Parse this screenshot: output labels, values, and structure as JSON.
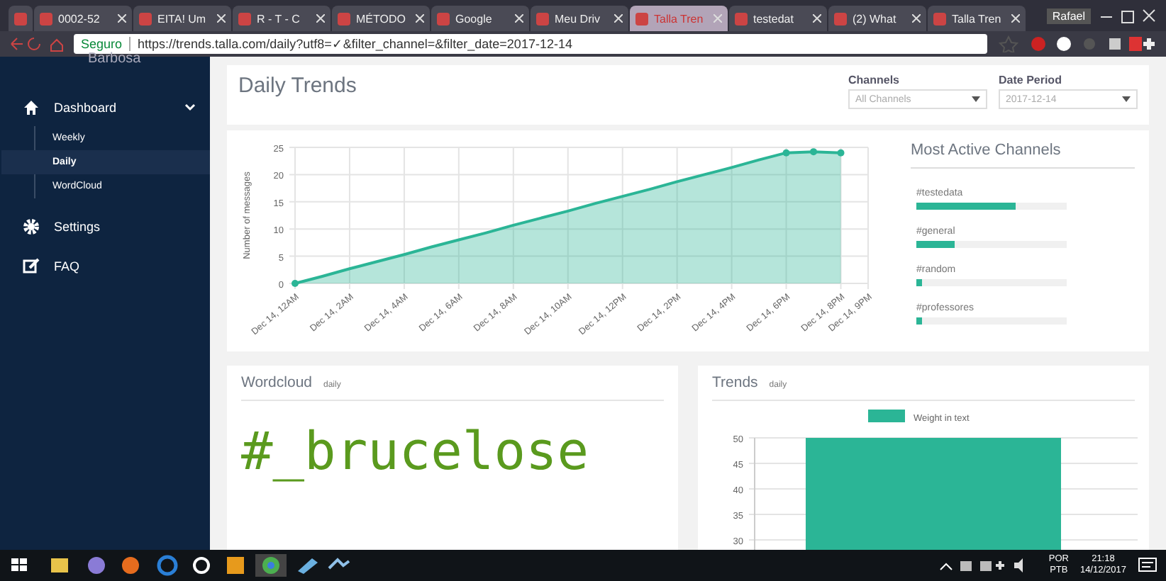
{
  "browser": {
    "tabs": [
      {
        "selected": false
      },
      {
        "title": "0002-52",
        "selected": false
      },
      {
        "title": "EITA! Um",
        "selected": false
      },
      {
        "title": "R - T - C",
        "selected": false
      },
      {
        "title": "MÉTODO",
        "selected": false
      },
      {
        "title": "Google",
        "selected": false
      },
      {
        "title": "Meu Driv",
        "selected": false
      },
      {
        "title": "Talla Tren",
        "selected": true
      },
      {
        "title": "testedat",
        "selected": false
      },
      {
        "title": "(2) What",
        "selected": false
      },
      {
        "title": "Talla Tren",
        "selected": false
      }
    ],
    "user": "Rafael",
    "secure_label": "Seguro",
    "url": "https://trends.talla.com/daily?utf8=✓&filter_channel=&filter_date=2017-12-14"
  },
  "sidebar": {
    "user_name": "Barbosa",
    "items": [
      {
        "label": "Dashboard",
        "expanded": true,
        "children": [
          {
            "label": "Weekly",
            "selected": false
          },
          {
            "label": "Daily",
            "selected": true
          },
          {
            "label": "WordCloud",
            "selected": false
          }
        ]
      },
      {
        "label": "Settings"
      },
      {
        "label": "FAQ"
      }
    ]
  },
  "header": {
    "title": "Daily Trends",
    "filters": [
      {
        "label": "Channels",
        "value": "All Channels"
      },
      {
        "label": "Date Period",
        "value": "2017-12-14"
      }
    ]
  },
  "trend_chart": {
    "chart_data": {
      "type": "area",
      "ylabel": "Number of messages",
      "grid": true,
      "ylim": [
        0,
        25
      ],
      "yticks": [
        0,
        5,
        10,
        15,
        20,
        25
      ],
      "categories": [
        "Dec 14, 12AM",
        null,
        "Dec 14, 2AM",
        null,
        "Dec 14, 4AM",
        null,
        "Dec 14, 6AM",
        null,
        "Dec 14, 8AM",
        null,
        "Dec 14, 10AM",
        null,
        "Dec 14, 12PM",
        null,
        "Dec 14, 2PM",
        null,
        "Dec 14, 4PM",
        null,
        "Dec 14, 6PM",
        null,
        "Dec 14, 8PM",
        "Dec 14, 9PM"
      ],
      "series": [
        {
          "color": "#2bb596",
          "values": [
            0,
            1.3,
            2.7,
            4,
            5.3,
            6.7,
            8,
            9.3,
            10.7,
            12,
            13.3,
            14.7,
            16,
            17.3,
            18.7,
            20,
            21.3,
            22.7,
            24,
            24.2,
            24,
            null
          ]
        }
      ]
    }
  },
  "active_channels": {
    "title": "Most Active Channels",
    "channels": [
      {
        "name": "#testedata",
        "level": 0.66
      },
      {
        "name": "#general",
        "level": 0.25
      },
      {
        "name": "#random",
        "level": 0.04
      },
      {
        "name": "#professores",
        "level": 0.04
      }
    ]
  },
  "wordcloud": {
    "title": "Wordcloud",
    "period": "daily",
    "words": [
      "#_brucelose"
    ]
  },
  "trends": {
    "title": "Trends",
    "period": "daily",
    "chart_data": {
      "type": "bar",
      "ylim": [
        0,
        50
      ],
      "grid": true,
      "yticks": [
        30,
        35,
        40,
        45,
        50
      ],
      "series": [
        {
          "name": "Weight in text",
          "color": "#2bb596",
          "values": [
            50
          ]
        }
      ]
    }
  },
  "taskbar": {
    "language": "POR",
    "layout": "PTB",
    "time": "21:18",
    "date": "14/12/2017"
  }
}
